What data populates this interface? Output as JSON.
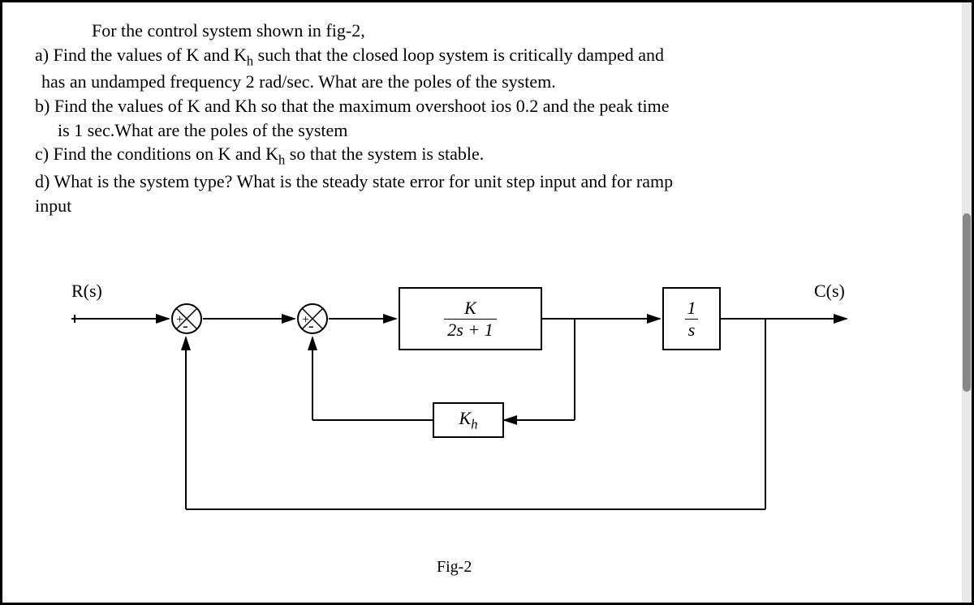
{
  "problem": {
    "intro": "For the control system shown in fig-2,",
    "a_line1_pre": "a)  Find the values of K and K",
    "a_line1_sub": "h",
    "a_line1_post": " such that the closed loop system is critically damped and",
    "a_line2": "has an undamped frequency 2 rad/sec. What are the poles of the system.",
    "b_line1": "b)  Find the values of K and Kh so that the maximum overshoot ios 0.2 and the peak time",
    "b_line2": "is 1 sec.What are the poles of the system",
    "c_pre": "c)  Find the conditions on K and K",
    "c_sub": "h",
    "c_post": " so that the system is stable.",
    "d_line1": "d)  What is the system type? What is the steady state error for unit step input and for ramp",
    "d_line2": "input"
  },
  "diagram": {
    "input": "R(s)",
    "output": "C(s)",
    "block1_num": "K",
    "block1_den": "2s + 1",
    "block2_num": "1",
    "block2_den": "s",
    "feedback_block_pre": "K",
    "feedback_block_sub": "h",
    "fig_label": "Fig-2"
  }
}
